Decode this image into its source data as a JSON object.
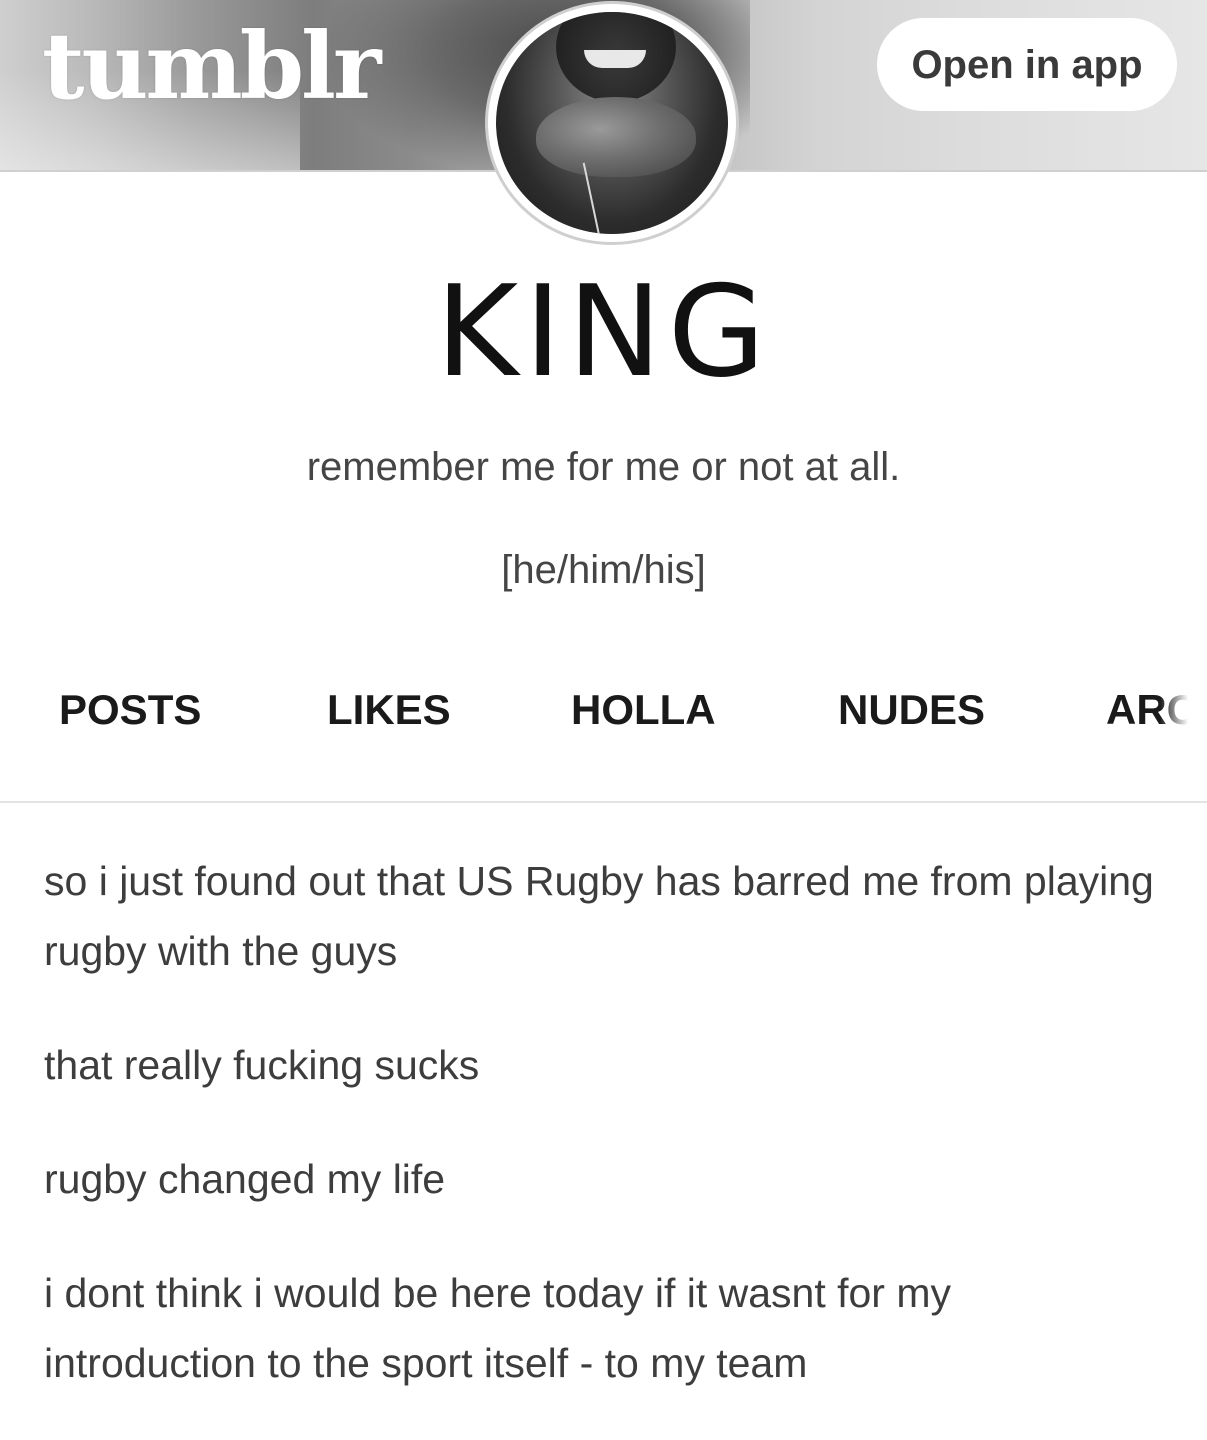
{
  "header": {
    "logo": "tumblr",
    "open_in_app_label": "Open in app"
  },
  "blog": {
    "title": "KING",
    "description": "remember me for me or not at all.",
    "pronouns": "[he/him/his]"
  },
  "nav": {
    "items": [
      {
        "label": "POSTS"
      },
      {
        "label": "LIKES"
      },
      {
        "label": "HOLLA"
      },
      {
        "label": "NUDES"
      },
      {
        "label": "ARCI"
      }
    ]
  },
  "post": {
    "paragraphs": [
      "so i just found out that US Rugby has barred me from playing rugby with the guys",
      "that really fucking sucks",
      "rugby changed my life",
      "i dont think i would be here today if it wasnt for my introduction to the sport itself - to my team"
    ]
  },
  "colors": {
    "background": "#ffffff",
    "text": "#3d3d3d",
    "heading": "#111111",
    "divider": "#e4e4e4"
  },
  "icons": {
    "avatar": "profile-photo"
  }
}
